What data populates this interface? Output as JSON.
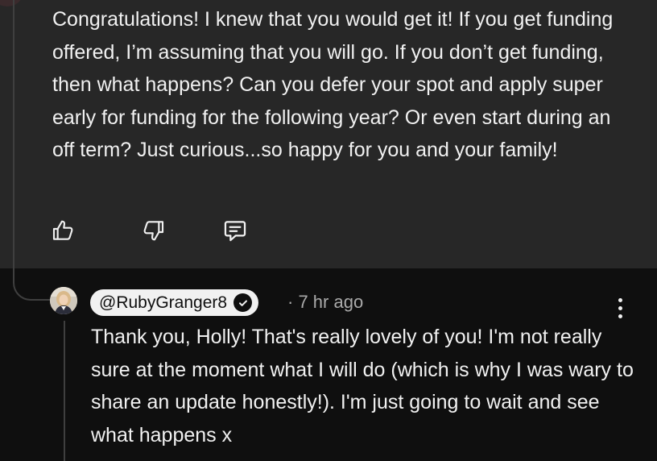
{
  "parent_comment": {
    "text": "Congratulations! I knew that you would get it! If you get funding offered, I’m assuming that you will go. If you don’t get funding, then what happens? Can you defer your spot and apply super early for funding for the following year? Or even start during an off term? Just curious...so happy for you and your family!",
    "actions": [
      {
        "icon": "thumb-up-icon"
      },
      {
        "icon": "thumb-down-icon"
      },
      {
        "icon": "reply-icon"
      }
    ]
  },
  "reply": {
    "author": "@RubyGranger8",
    "verified": true,
    "separator": "·",
    "time": "7 hr ago",
    "text": "Thank you, Holly! That's really lovely of you! I'm not really sure at the moment what I will do (which is why I was wary to share an update honestly!). I'm just going to wait and see what happens x",
    "menu_icon": "more-vertical-icon"
  },
  "colors": {
    "parent_background": "#272727",
    "page_background": "#0f0f0f",
    "text": "#f1f1f1",
    "muted_text": "#aaaaaa",
    "chip_background": "#f1f1f1"
  }
}
